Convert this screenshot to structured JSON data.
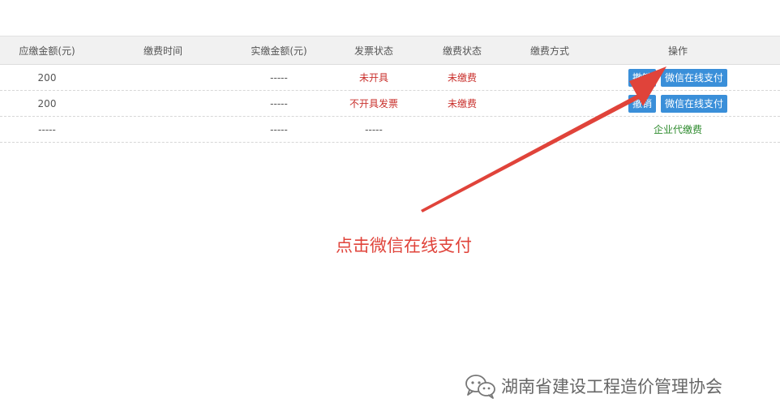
{
  "table": {
    "headers": [
      "应缴金额(元)",
      "缴费时间",
      "实缴金额(元)",
      "发票状态",
      "缴费状态",
      "缴费方式",
      "操作"
    ],
    "rows": [
      {
        "due_amount": "200",
        "pay_time": "",
        "paid_amount": "-----",
        "invoice_status": "未开具",
        "payment_status": "未缴费",
        "payment_method": "",
        "cancel_label": "撤销",
        "wechat_pay_label": "微信在线支付"
      },
      {
        "due_amount": "200",
        "pay_time": "",
        "paid_amount": "-----",
        "invoice_status": "不开具发票",
        "payment_status": "未缴费",
        "payment_method": "",
        "cancel_label": "撤销",
        "wechat_pay_label": "微信在线支付"
      },
      {
        "due_amount": "-----",
        "pay_time": "",
        "paid_amount": "-----",
        "invoice_status": "-----",
        "payment_status": "",
        "payment_method": "",
        "operation_text": "企业代缴费"
      }
    ]
  },
  "annotation": {
    "text": "点击微信在线支付"
  },
  "watermark": {
    "text": "湖南省建设工程造价管理协会",
    "icon": "wechat-icon"
  },
  "colors": {
    "button_bg": "#3a8fd9",
    "status_red": "#c9302c",
    "agency_green": "#2e8b2e",
    "annotation_red": "#e0433a"
  }
}
